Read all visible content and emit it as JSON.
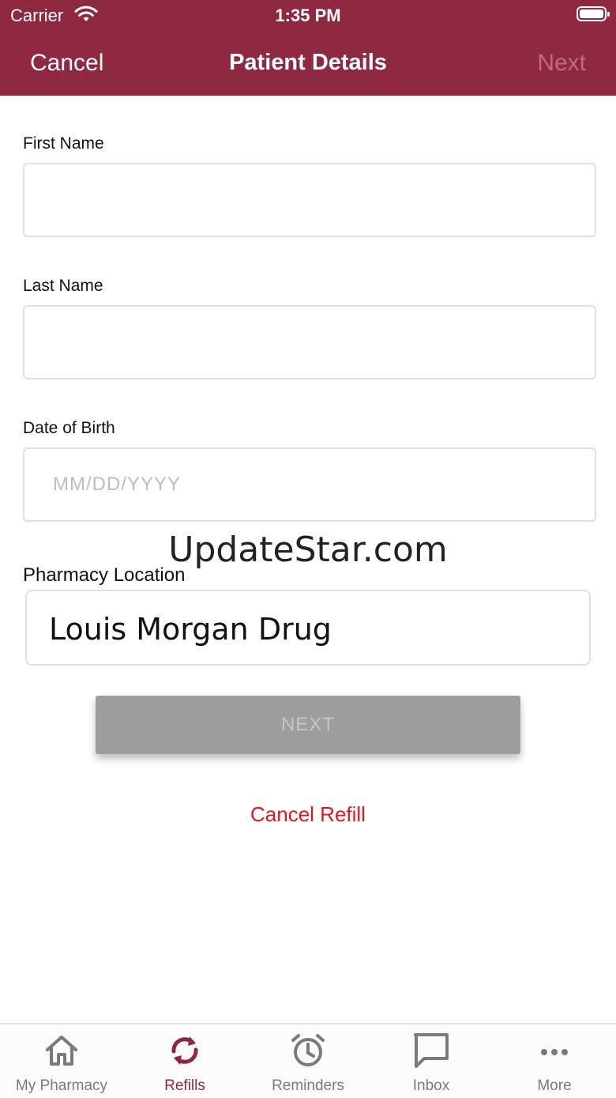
{
  "status_bar": {
    "carrier": "Carrier",
    "time": "1:35 PM"
  },
  "nav": {
    "cancel": "Cancel",
    "title": "Patient Details",
    "next": "Next"
  },
  "form": {
    "first_name": {
      "label": "First Name",
      "value": "",
      "placeholder": ""
    },
    "last_name": {
      "label": "Last Name",
      "value": "",
      "placeholder": ""
    },
    "dob": {
      "label": "Date of Birth",
      "value": "",
      "placeholder": "MM/DD/YYYY"
    },
    "pharmacy": {
      "label": "Pharmacy Location",
      "value": "Louis Morgan Drug"
    }
  },
  "watermark": "UpdateStar.com",
  "next_button": "NEXT",
  "cancel_refill": "Cancel Refill",
  "colors": {
    "brand": "#8f2942",
    "danger": "#e3161e",
    "disabled": "#9e9e9e"
  },
  "tabs": [
    {
      "label": "My Pharmacy",
      "icon": "home-icon",
      "active": false
    },
    {
      "label": "Refills",
      "icon": "refresh-icon",
      "active": true
    },
    {
      "label": "Reminders",
      "icon": "alarm-clock-icon",
      "active": false
    },
    {
      "label": "Inbox",
      "icon": "chat-bubble-icon",
      "active": false
    },
    {
      "label": "More",
      "icon": "ellipsis-icon",
      "active": false
    }
  ]
}
